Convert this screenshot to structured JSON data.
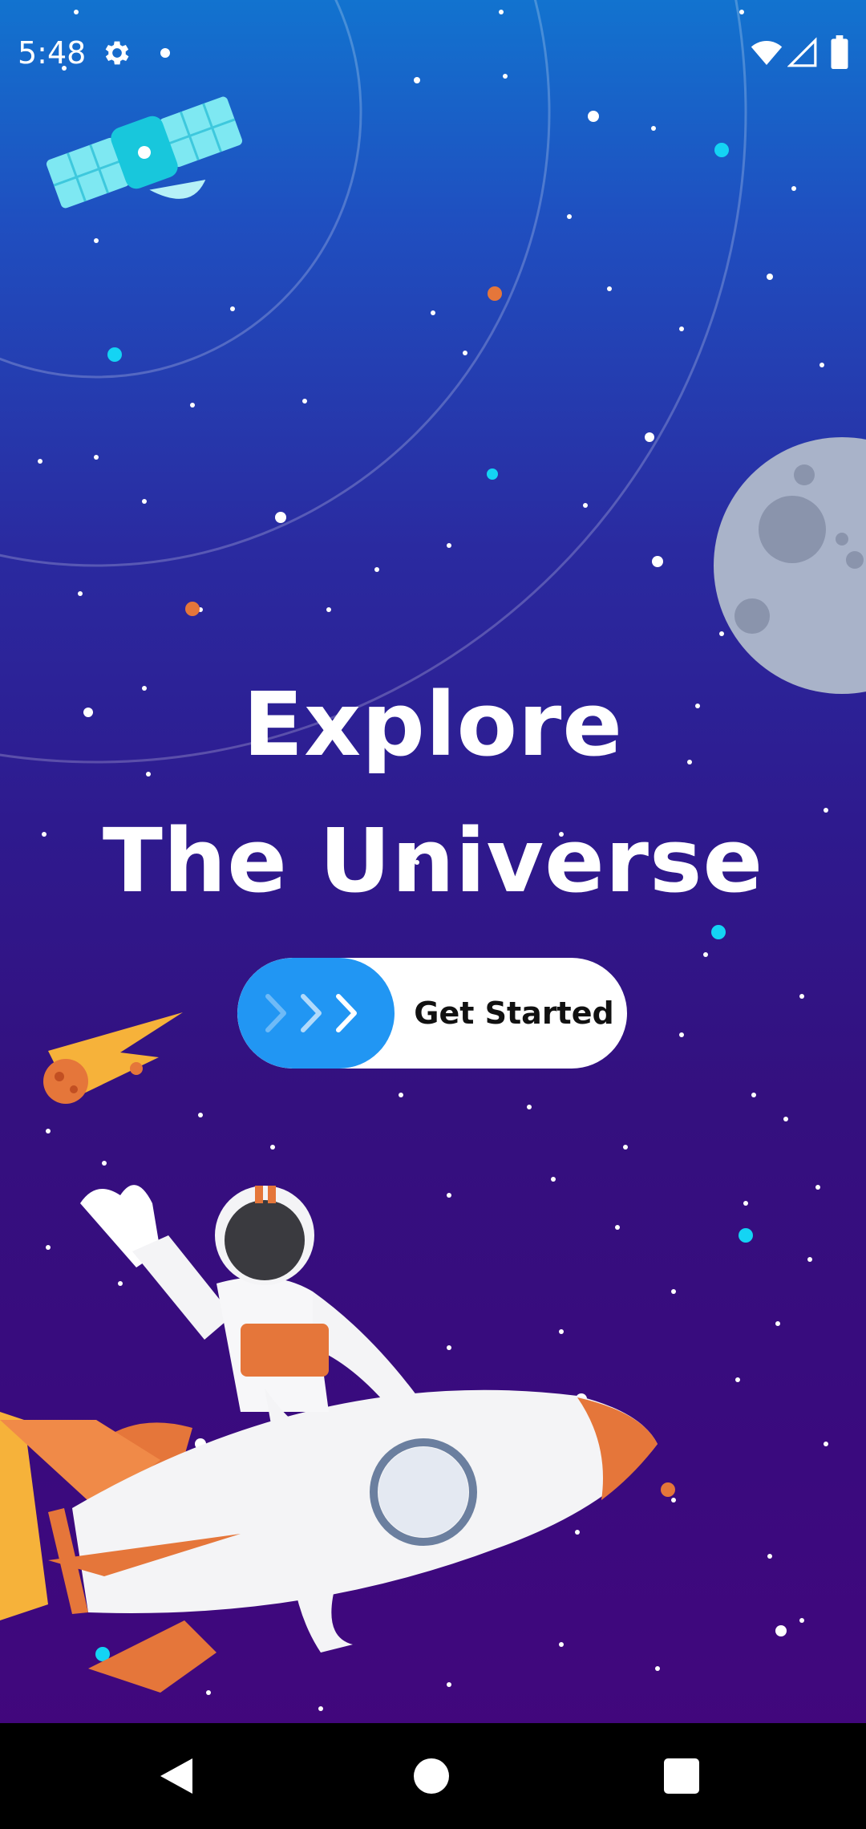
{
  "status_bar": {
    "time": "5:48",
    "icons": [
      "settings-icon",
      "notification-dot-icon",
      "wifi-icon",
      "cell-signal-icon",
      "battery-icon"
    ]
  },
  "hero": {
    "title_line1": "Explore",
    "title_line2": "The Universe"
  },
  "cta": {
    "label": "Get Started",
    "knob_color": "#2196f3",
    "icon": "chevrons-right-icon"
  },
  "illustrations": [
    "satellite-icon",
    "moon-icon",
    "comet-icon",
    "astronaut-icon",
    "rocket-icon",
    "orbit-rings",
    "stars"
  ],
  "nav_bar": {
    "icons": [
      "back-icon",
      "home-icon",
      "recents-icon"
    ]
  },
  "colors": {
    "bg_top": "#1273cf",
    "bg_bottom": "#44067c",
    "accent_cyan": "#14d4f4",
    "accent_orange": "#e5763a"
  }
}
